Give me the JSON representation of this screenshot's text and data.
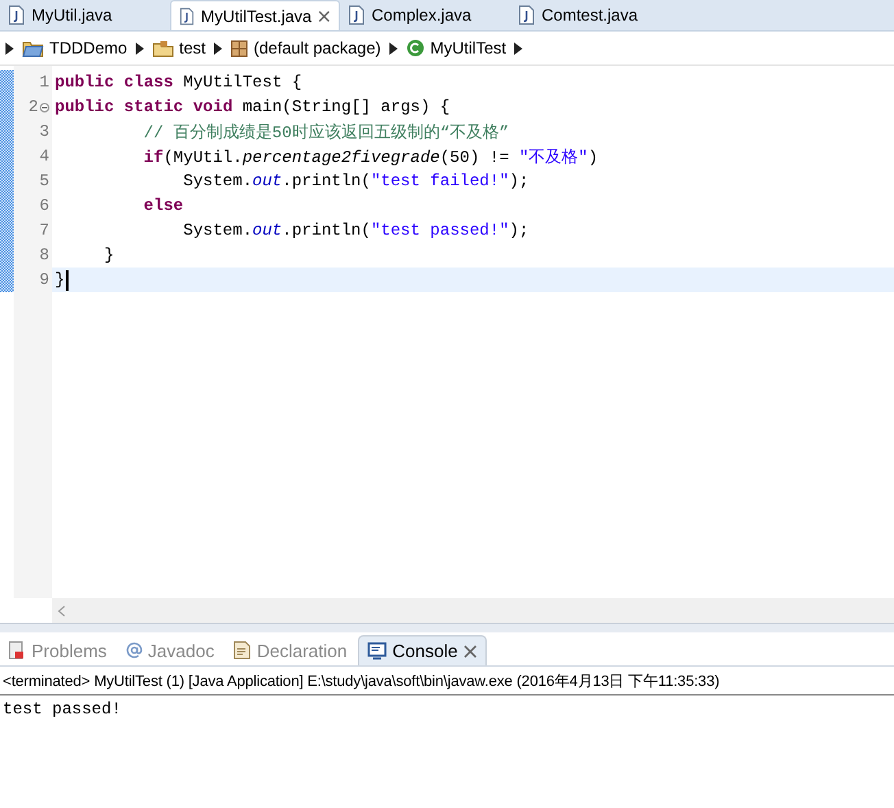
{
  "editor_tabs": [
    {
      "label": "MyUtil.java",
      "selected": false,
      "closable": false
    },
    {
      "label": "MyUtilTest.java",
      "selected": true,
      "closable": true
    },
    {
      "label": "Complex.java",
      "selected": false,
      "closable": false
    },
    {
      "label": "Comtest.java",
      "selected": false,
      "closable": false
    }
  ],
  "breadcrumb": [
    {
      "kind": "project",
      "label": "TDDDemo"
    },
    {
      "kind": "folder",
      "label": "test"
    },
    {
      "kind": "package",
      "label": "(default package)"
    },
    {
      "kind": "class",
      "label": "MyUtilTest"
    }
  ],
  "code_lines": [
    {
      "number": "1",
      "current": false,
      "fold": false,
      "tokens": [
        {
          "kind": "kw",
          "text": "public"
        },
        {
          "kind": "kw",
          "text": " class"
        },
        {
          "kind": "plain",
          "text": " MyUtilTest {"
        }
      ]
    },
    {
      "number": "2",
      "current": false,
      "fold": true,
      "tokens": [
        {
          "kind": "kw",
          "text": "public"
        },
        {
          "kind": "kw",
          "text": " static"
        },
        {
          "kind": "kw",
          "text": " void"
        },
        {
          "kind": "plain",
          "text": " main(String[] args) {"
        }
      ]
    },
    {
      "number": "3",
      "current": false,
      "fold": false,
      "tokens": [
        {
          "kind": "comment",
          "text": "         // 百分制成绩是50时应该返回五级制的“不及格”"
        }
      ]
    },
    {
      "number": "4",
      "current": false,
      "fold": false,
      "tokens": [
        {
          "kind": "kw",
          "text": "         if"
        },
        {
          "kind": "plain",
          "text": "(MyUtil."
        },
        {
          "kind": "static",
          "text": "percentage2fivegrade"
        },
        {
          "kind": "plain",
          "text": "(50) != "
        },
        {
          "kind": "string",
          "text": "\"不及格\""
        },
        {
          "kind": "plain",
          "text": ")"
        }
      ]
    },
    {
      "number": "5",
      "current": false,
      "fold": false,
      "tokens": [
        {
          "kind": "plain",
          "text": "             System."
        },
        {
          "kind": "field",
          "text": "out"
        },
        {
          "kind": "plain",
          "text": ".println("
        },
        {
          "kind": "string",
          "text": "\"test failed!\""
        },
        {
          "kind": "plain",
          "text": ");"
        }
      ]
    },
    {
      "number": "6",
      "current": false,
      "fold": false,
      "tokens": [
        {
          "kind": "kw",
          "text": "         else"
        }
      ]
    },
    {
      "number": "7",
      "current": false,
      "fold": false,
      "tokens": [
        {
          "kind": "plain",
          "text": "             System."
        },
        {
          "kind": "field",
          "text": "out"
        },
        {
          "kind": "plain",
          "text": ".println("
        },
        {
          "kind": "string",
          "text": "\"test passed!\""
        },
        {
          "kind": "plain",
          "text": ");"
        }
      ]
    },
    {
      "number": "8",
      "current": false,
      "fold": false,
      "tokens": [
        {
          "kind": "plain",
          "text": "     }"
        }
      ]
    },
    {
      "number": "9",
      "current": true,
      "fold": false,
      "tokens": [
        {
          "kind": "plain",
          "text": "}"
        }
      ]
    }
  ],
  "view_tabs": [
    {
      "kind": "problems",
      "label": "Problems",
      "selected": false,
      "closable": false
    },
    {
      "kind": "javadoc",
      "label": "Javadoc",
      "selected": false,
      "closable": false
    },
    {
      "kind": "declaration",
      "label": "Declaration",
      "selected": false,
      "closable": false
    },
    {
      "kind": "console",
      "label": "Console",
      "selected": true,
      "closable": true
    }
  ],
  "console": {
    "header": "<terminated> MyUtilTest (1) [Java Application] E:\\study\\java\\soft\\bin\\javaw.exe (2016年4月13日 下午11:35:33)",
    "output": "test passed!"
  }
}
